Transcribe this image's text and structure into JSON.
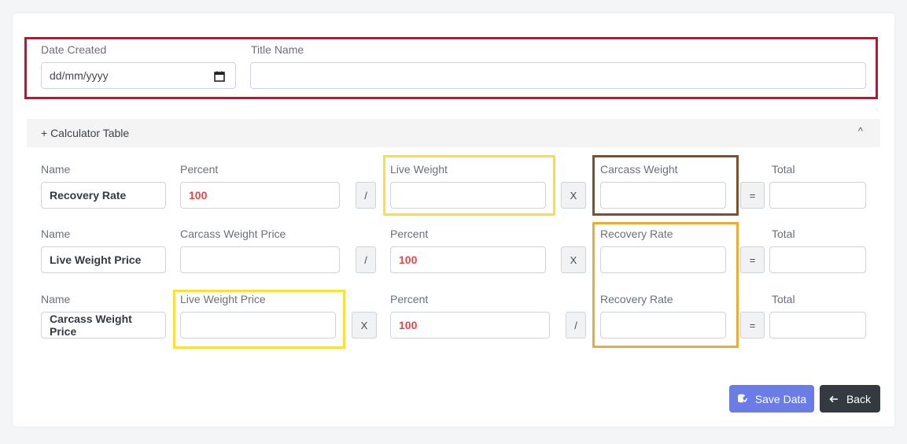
{
  "header": {
    "date_label": "Date Created",
    "date_placeholder": "dd/mm/yyyy",
    "title_label": "Title Name",
    "title_value": ""
  },
  "accordion": {
    "label": "+ Calculator Table",
    "chevron": "^"
  },
  "labels": {
    "name": "Name",
    "percent": "Percent",
    "live_weight": "Live Weight",
    "carcass_weight": "Carcass Weight",
    "total": "Total",
    "carcass_weight_price": "Carcass Weight Price",
    "recovery_rate": "Recovery Rate",
    "live_weight_price": "Live Weight Price"
  },
  "rows": [
    {
      "name": "Recovery Rate",
      "percent": "100",
      "op1": "/",
      "op2": "X",
      "eq": "="
    },
    {
      "name": "Live Weight Price",
      "percent": "100",
      "op1": "/",
      "op2": "X",
      "eq": "="
    },
    {
      "name": "Carcass Weight Price",
      "percent": "100",
      "op1": "X",
      "op2": "/",
      "eq": "="
    }
  ],
  "buttons": {
    "save": "Save Data",
    "back": "Back"
  },
  "colors": {
    "highlight_red": "#c8102e",
    "highlight_yellow": "#f5e23b",
    "highlight_brown": "#7a5230",
    "highlight_orange": "#f0a935",
    "save_button": "#6a7ce6",
    "back_button": "#343a40",
    "percent_text": "#e0464b"
  },
  "icons": {
    "calendar": "calendar-icon",
    "save": "database-save-icon",
    "back": "arrow-left-icon",
    "chevron": "chevron-up-icon"
  }
}
